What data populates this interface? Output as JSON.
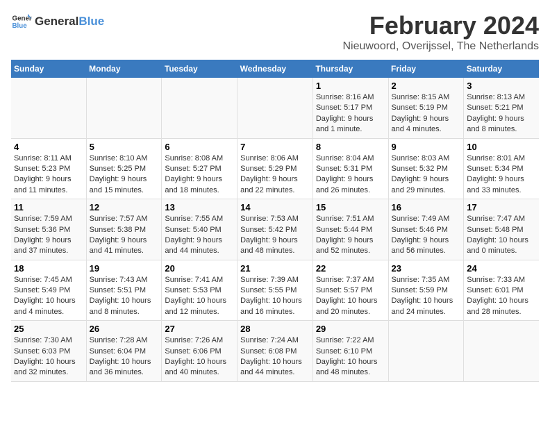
{
  "logo": {
    "text_general": "General",
    "text_blue": "Blue"
  },
  "title": "February 2024",
  "subtitle": "Nieuwoord, Overijssel, The Netherlands",
  "days_header": [
    "Sunday",
    "Monday",
    "Tuesday",
    "Wednesday",
    "Thursday",
    "Friday",
    "Saturday"
  ],
  "weeks": [
    [
      {
        "day": "",
        "info": ""
      },
      {
        "day": "",
        "info": ""
      },
      {
        "day": "",
        "info": ""
      },
      {
        "day": "",
        "info": ""
      },
      {
        "day": "1",
        "info": "Sunrise: 8:16 AM\nSunset: 5:17 PM\nDaylight: 9 hours\nand 1 minute."
      },
      {
        "day": "2",
        "info": "Sunrise: 8:15 AM\nSunset: 5:19 PM\nDaylight: 9 hours\nand 4 minutes."
      },
      {
        "day": "3",
        "info": "Sunrise: 8:13 AM\nSunset: 5:21 PM\nDaylight: 9 hours\nand 8 minutes."
      }
    ],
    [
      {
        "day": "4",
        "info": "Sunrise: 8:11 AM\nSunset: 5:23 PM\nDaylight: 9 hours\nand 11 minutes."
      },
      {
        "day": "5",
        "info": "Sunrise: 8:10 AM\nSunset: 5:25 PM\nDaylight: 9 hours\nand 15 minutes."
      },
      {
        "day": "6",
        "info": "Sunrise: 8:08 AM\nSunset: 5:27 PM\nDaylight: 9 hours\nand 18 minutes."
      },
      {
        "day": "7",
        "info": "Sunrise: 8:06 AM\nSunset: 5:29 PM\nDaylight: 9 hours\nand 22 minutes."
      },
      {
        "day": "8",
        "info": "Sunrise: 8:04 AM\nSunset: 5:31 PM\nDaylight: 9 hours\nand 26 minutes."
      },
      {
        "day": "9",
        "info": "Sunrise: 8:03 AM\nSunset: 5:32 PM\nDaylight: 9 hours\nand 29 minutes."
      },
      {
        "day": "10",
        "info": "Sunrise: 8:01 AM\nSunset: 5:34 PM\nDaylight: 9 hours\nand 33 minutes."
      }
    ],
    [
      {
        "day": "11",
        "info": "Sunrise: 7:59 AM\nSunset: 5:36 PM\nDaylight: 9 hours\nand 37 minutes."
      },
      {
        "day": "12",
        "info": "Sunrise: 7:57 AM\nSunset: 5:38 PM\nDaylight: 9 hours\nand 41 minutes."
      },
      {
        "day": "13",
        "info": "Sunrise: 7:55 AM\nSunset: 5:40 PM\nDaylight: 9 hours\nand 44 minutes."
      },
      {
        "day": "14",
        "info": "Sunrise: 7:53 AM\nSunset: 5:42 PM\nDaylight: 9 hours\nand 48 minutes."
      },
      {
        "day": "15",
        "info": "Sunrise: 7:51 AM\nSunset: 5:44 PM\nDaylight: 9 hours\nand 52 minutes."
      },
      {
        "day": "16",
        "info": "Sunrise: 7:49 AM\nSunset: 5:46 PM\nDaylight: 9 hours\nand 56 minutes."
      },
      {
        "day": "17",
        "info": "Sunrise: 7:47 AM\nSunset: 5:48 PM\nDaylight: 10 hours\nand 0 minutes."
      }
    ],
    [
      {
        "day": "18",
        "info": "Sunrise: 7:45 AM\nSunset: 5:49 PM\nDaylight: 10 hours\nand 4 minutes."
      },
      {
        "day": "19",
        "info": "Sunrise: 7:43 AM\nSunset: 5:51 PM\nDaylight: 10 hours\nand 8 minutes."
      },
      {
        "day": "20",
        "info": "Sunrise: 7:41 AM\nSunset: 5:53 PM\nDaylight: 10 hours\nand 12 minutes."
      },
      {
        "day": "21",
        "info": "Sunrise: 7:39 AM\nSunset: 5:55 PM\nDaylight: 10 hours\nand 16 minutes."
      },
      {
        "day": "22",
        "info": "Sunrise: 7:37 AM\nSunset: 5:57 PM\nDaylight: 10 hours\nand 20 minutes."
      },
      {
        "day": "23",
        "info": "Sunrise: 7:35 AM\nSunset: 5:59 PM\nDaylight: 10 hours\nand 24 minutes."
      },
      {
        "day": "24",
        "info": "Sunrise: 7:33 AM\nSunset: 6:01 PM\nDaylight: 10 hours\nand 28 minutes."
      }
    ],
    [
      {
        "day": "25",
        "info": "Sunrise: 7:30 AM\nSunset: 6:03 PM\nDaylight: 10 hours\nand 32 minutes."
      },
      {
        "day": "26",
        "info": "Sunrise: 7:28 AM\nSunset: 6:04 PM\nDaylight: 10 hours\nand 36 minutes."
      },
      {
        "day": "27",
        "info": "Sunrise: 7:26 AM\nSunset: 6:06 PM\nDaylight: 10 hours\nand 40 minutes."
      },
      {
        "day": "28",
        "info": "Sunrise: 7:24 AM\nSunset: 6:08 PM\nDaylight: 10 hours\nand 44 minutes."
      },
      {
        "day": "29",
        "info": "Sunrise: 7:22 AM\nSunset: 6:10 PM\nDaylight: 10 hours\nand 48 minutes."
      },
      {
        "day": "",
        "info": ""
      },
      {
        "day": "",
        "info": ""
      }
    ]
  ]
}
